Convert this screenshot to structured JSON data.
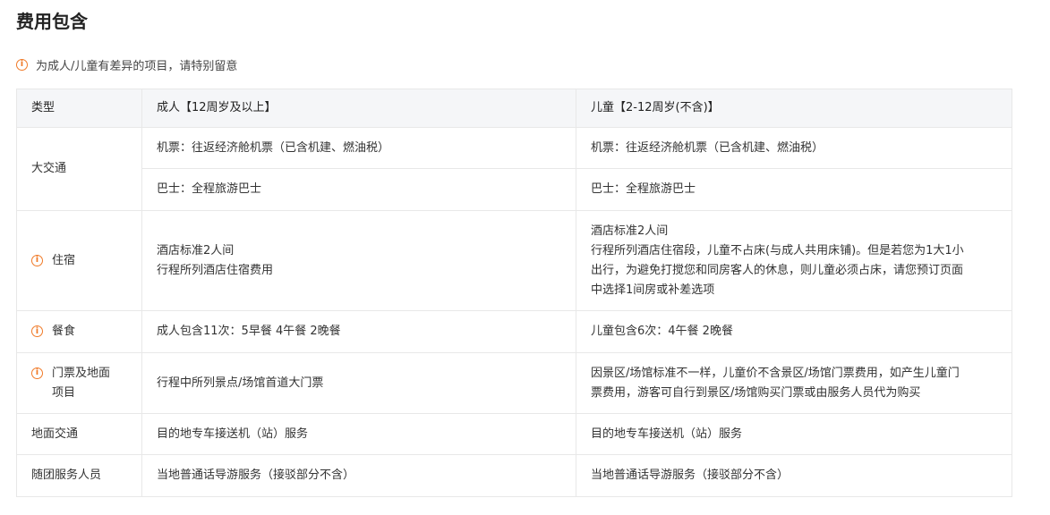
{
  "page": {
    "title": "费用包含",
    "notice": "为成人/儿童有差异的项目，请特别留意"
  },
  "table": {
    "headers": [
      "类型",
      "成人【12周岁及以上】",
      "儿童【2-12周岁(不含)】"
    ],
    "rows": {
      "transport": {
        "type": "大交通",
        "flight": {
          "adult": "机票：往返经济舱机票（已含机建、燃油税）",
          "child": "机票：往返经济舱机票（已含机建、燃油税）"
        },
        "bus": {
          "adult": "巴士：全程旅游巴士",
          "child": "巴士：全程旅游巴士"
        }
      },
      "lodging": {
        "type": "住宿",
        "adult": [
          "酒店标准2人间",
          "行程所列酒店住宿费用"
        ],
        "child": [
          "酒店标准2人间",
          "行程所列酒店住宿段，儿童不占床(与成人共用床铺)。但是若您为1大1小",
          "出行，为避免打搅您和同房客人的休息，则儿童必须占床，请您预订页面",
          "中选择1间房或补差选项"
        ]
      },
      "meals": {
        "type": "餐食",
        "adult": "成人包含11次：5早餐 4午餐 2晚餐",
        "child": "儿童包含6次：4午餐 2晚餐"
      },
      "tickets": {
        "type": [
          "门票及地面",
          "项目"
        ],
        "adult": "行程中所列景点/场馆首道大门票",
        "child": [
          "因景区/场馆标准不一样，儿童价不含景区/场馆门票费用，如产生儿童门",
          "票费用，游客可自行到景区/场馆购买门票或由服务人员代为购买"
        ]
      },
      "ground": {
        "type": "地面交通",
        "adult": "目的地专车接送机（站）服务",
        "child": "目的地专车接送机（站）服务"
      },
      "staff": {
        "type": "随团服务人员",
        "adult": "当地普通话导游服务（接驳部分不含）",
        "child": "当地普通话导游服务（接驳部分不含）"
      }
    }
  },
  "icons": {
    "info": "info-circle-icon"
  },
  "colors": {
    "accent": "#f07a28",
    "header_bg": "#f5f6f8",
    "border": "#e8e8e8"
  }
}
